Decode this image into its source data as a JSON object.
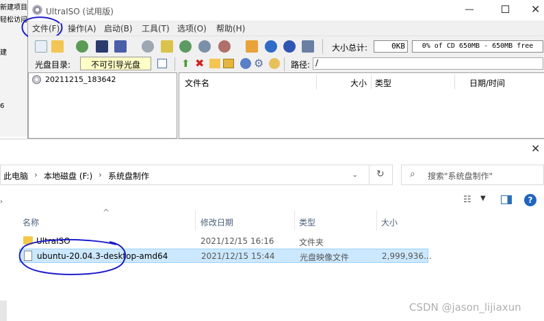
{
  "background_window": {
    "items": [
      "新建项目",
      "轻松访问",
      "建",
      "6"
    ]
  },
  "ultraiso": {
    "title": "UltraISO (试用版)",
    "menu": [
      "文件(F)",
      "操作(A)",
      "启动(B)",
      "工具(T)",
      "选项(O)",
      "帮助(H)"
    ],
    "size_total_label": "大小总计:",
    "size_total_value": "0KB",
    "capacity_text": "0% of CD 650MB - 650MB free",
    "disc_dir_label": "光盘目录:",
    "boot_type": "不可引导光盘",
    "path_label": "路径:",
    "path_value": "/",
    "tree_item": "20211215_183642",
    "columns": [
      "文件名",
      "大小",
      "类型",
      "日期/时间"
    ]
  },
  "explorer": {
    "breadcrumb": [
      "此电脑",
      "本地磁盘 (F:)",
      "系统盘制作"
    ],
    "search_placeholder": "搜索\"系统盘制作\"",
    "columns": [
      "名称",
      "修改日期",
      "类型",
      "大小"
    ],
    "files": [
      {
        "name": "UltraISO",
        "date": "2021/12/15 16:16",
        "type": "文件夹",
        "size": "",
        "icon": "folder-icon"
      },
      {
        "name": "ubuntu-20.04.3-desktop-amd64",
        "date": "2021/12/15 15:44",
        "type": "光盘映像文件",
        "size": "2,999,936...",
        "icon": "disc-image-icon"
      }
    ]
  },
  "watermark": "CSDN @jason_lijiaxun",
  "colors": {
    "annotation_ink": "#1a1acc",
    "selection_bg": "#cce8ff",
    "folder_yellow": "#f5c84a"
  }
}
